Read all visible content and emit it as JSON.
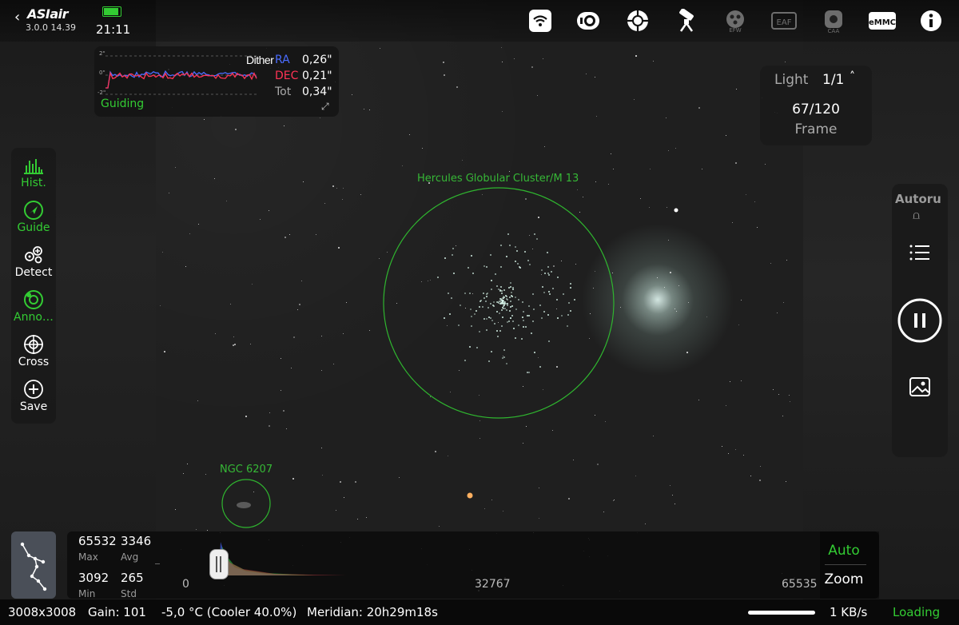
{
  "app": {
    "name": "ASIair",
    "version": "3.0.0 14.39",
    "time": "21:11"
  },
  "topbar": {
    "icons": [
      {
        "name": "wifi-icon",
        "label": ""
      },
      {
        "name": "camera-icon",
        "label": ""
      },
      {
        "name": "guide-scope-icon",
        "label": ""
      },
      {
        "name": "mount-icon",
        "label": ""
      },
      {
        "name": "filter-wheel-icon",
        "label": "EFW"
      },
      {
        "name": "focuser-icon",
        "label": "EAF"
      },
      {
        "name": "camera-angle-icon",
        "label": "CAA"
      },
      {
        "name": "emmc-icon",
        "label": "eMMC"
      },
      {
        "name": "info-icon",
        "label": ""
      }
    ]
  },
  "guiding": {
    "title": "Guiding",
    "dither": "Dither",
    "axis_top": "2\"",
    "axis_mid": "0\"",
    "axis_bot": "-2\"",
    "ra_label": "RA",
    "ra_value": "0,26\"",
    "dec_label": "DEC",
    "dec_value": "0,21\"",
    "tot_label": "Tot",
    "tot_value": "0,34\""
  },
  "left_bar": {
    "hist": "Hist.",
    "guide": "Guide",
    "detect": "Detect",
    "anno": "Anno…",
    "cross": "Cross",
    "save": "Save"
  },
  "annotations": {
    "m13": "Hercules Globular Cluster/M 13",
    "ngc": "NGC 6207"
  },
  "exposure": {
    "type": "Light",
    "count": "1/1",
    "frames": "67/120",
    "frame_label": "Frame"
  },
  "right_bar": {
    "autorun": "Autoru"
  },
  "stats": {
    "max_value": "65532",
    "max_label": "Max",
    "avg_value": "3346",
    "avg_label": "Avg",
    "min_value": "3092",
    "min_label": "Min",
    "std_value": "265",
    "std_label": "Std"
  },
  "histogram": {
    "tick_0": "0",
    "tick_mid": "32767",
    "tick_max": "65535"
  },
  "stretch": {
    "auto": "Auto",
    "zoom": "Zoom"
  },
  "status": {
    "resolution": "3008x3008",
    "gain": "Gain: 101",
    "temperature": "-5,0 °C (Cooler 40.0%)",
    "meridian": "Meridian: 20h29m18s",
    "speed": "1 KB/s",
    "loading": "Loading"
  },
  "colors": {
    "accent": "#33cc33",
    "ra": "#4a6cff",
    "dec": "#ff3355"
  }
}
